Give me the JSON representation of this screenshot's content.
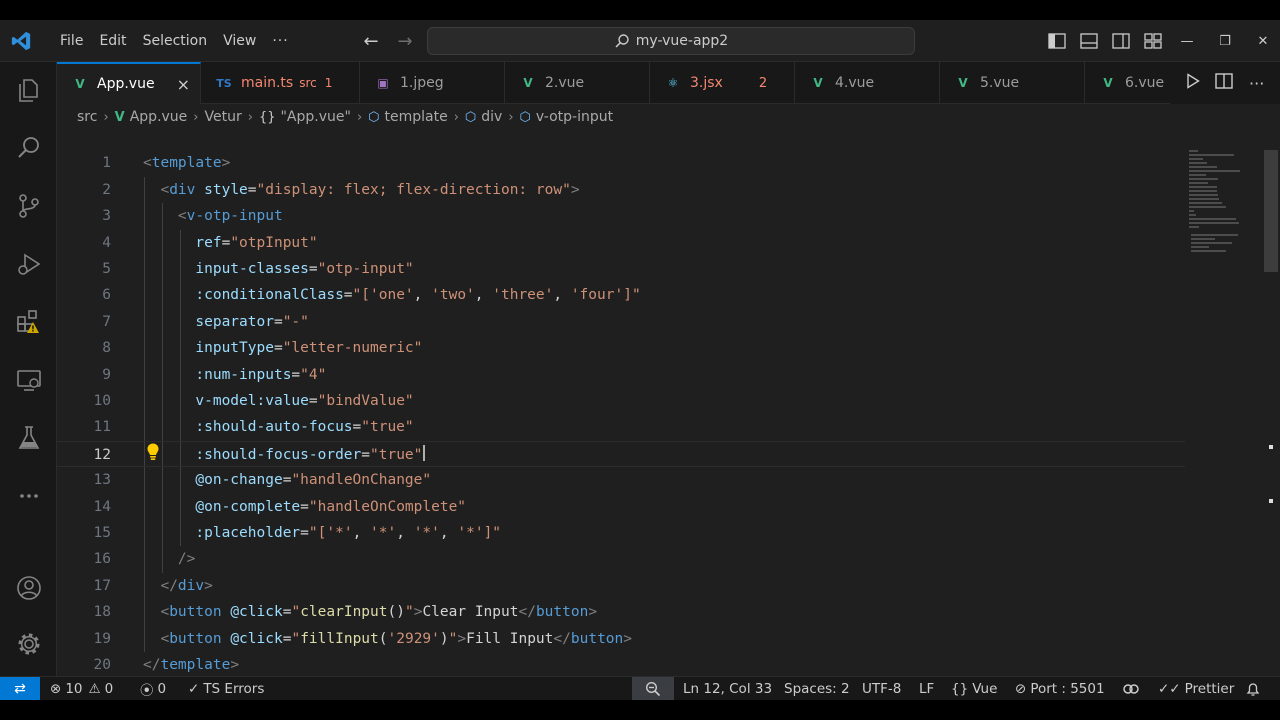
{
  "menu": {
    "items": [
      "File",
      "Edit",
      "Selection",
      "View",
      "···"
    ]
  },
  "search": {
    "text": "my-vue-app2"
  },
  "tabs": [
    {
      "label": "App.vue",
      "icon": "vue-icon",
      "active": true
    },
    {
      "label": "main.ts",
      "sub": "src",
      "badge": "1",
      "icon": "ts-icon"
    },
    {
      "label": "1.jpeg",
      "icon": "image-icon"
    },
    {
      "label": "2.vue",
      "icon": "vue-icon"
    },
    {
      "label": "3.jsx",
      "badge": "2",
      "icon": "react-icon"
    },
    {
      "label": "4.vue",
      "icon": "vue-icon"
    },
    {
      "label": "5.vue",
      "icon": "vue-icon"
    },
    {
      "label": "6.vue",
      "icon": "vue-icon"
    }
  ],
  "breadcrumb": {
    "parts": [
      "src",
      "App.vue",
      "Vetur",
      "\"App.vue\"",
      "template",
      "div",
      "v-otp-input"
    ],
    "braces": "{}"
  },
  "editor": {
    "current_line": 12,
    "lines": [
      [
        [
          "punc",
          "<"
        ],
        [
          "tag",
          "template"
        ],
        [
          "punc",
          ">"
        ]
      ],
      [
        [
          "punc",
          "  <"
        ],
        [
          "tag",
          "div"
        ],
        [
          "txt",
          " "
        ],
        [
          "attr",
          "style"
        ],
        [
          "txt",
          "="
        ],
        [
          "str",
          "\"display: flex; flex-direction: row\""
        ],
        [
          "punc",
          ">"
        ]
      ],
      [
        [
          "punc",
          "    <"
        ],
        [
          "tag",
          "v-otp-input"
        ]
      ],
      [
        [
          "txt",
          "      "
        ],
        [
          "attr",
          "ref"
        ],
        [
          "txt",
          "="
        ],
        [
          "str",
          "\"otpInput\""
        ]
      ],
      [
        [
          "txt",
          "      "
        ],
        [
          "attr",
          "input-classes"
        ],
        [
          "txt",
          "="
        ],
        [
          "str",
          "\"otp-input\""
        ]
      ],
      [
        [
          "txt",
          "      "
        ],
        [
          "attr",
          ":conditionalClass"
        ],
        [
          "txt",
          "="
        ],
        [
          "str",
          "\"["
        ],
        [
          "str",
          "'one'"
        ],
        [
          "txt",
          ", "
        ],
        [
          "str",
          "'two'"
        ],
        [
          "txt",
          ", "
        ],
        [
          "str",
          "'three'"
        ],
        [
          "txt",
          ", "
        ],
        [
          "str",
          "'four'"
        ],
        [
          "str",
          "]\""
        ]
      ],
      [
        [
          "txt",
          "      "
        ],
        [
          "attr",
          "separator"
        ],
        [
          "txt",
          "="
        ],
        [
          "str",
          "\"-\""
        ]
      ],
      [
        [
          "txt",
          "      "
        ],
        [
          "attr",
          "inputType"
        ],
        [
          "txt",
          "="
        ],
        [
          "str",
          "\"letter-numeric\""
        ]
      ],
      [
        [
          "txt",
          "      "
        ],
        [
          "attr",
          ":num-inputs"
        ],
        [
          "txt",
          "="
        ],
        [
          "str",
          "\"4\""
        ]
      ],
      [
        [
          "txt",
          "      "
        ],
        [
          "attr",
          "v-model:value"
        ],
        [
          "txt",
          "="
        ],
        [
          "str",
          "\"bindValue\""
        ]
      ],
      [
        [
          "txt",
          "      "
        ],
        [
          "attr",
          ":should-auto-focus"
        ],
        [
          "txt",
          "="
        ],
        [
          "str",
          "\"true\""
        ]
      ],
      [
        [
          "txt",
          "      "
        ],
        [
          "attr",
          ":should-focus-order"
        ],
        [
          "txt",
          "="
        ],
        [
          "str",
          "\"true\""
        ]
      ],
      [
        [
          "txt",
          "      "
        ],
        [
          "attr",
          "@on-change"
        ],
        [
          "txt",
          "="
        ],
        [
          "str",
          "\"handleOnChange\""
        ]
      ],
      [
        [
          "txt",
          "      "
        ],
        [
          "attr",
          "@on-complete"
        ],
        [
          "txt",
          "="
        ],
        [
          "str",
          "\"handleOnComplete\""
        ]
      ],
      [
        [
          "txt",
          "      "
        ],
        [
          "attr",
          ":placeholder"
        ],
        [
          "txt",
          "="
        ],
        [
          "str",
          "\"["
        ],
        [
          "str",
          "'*'"
        ],
        [
          "txt",
          ", "
        ],
        [
          "str",
          "'*'"
        ],
        [
          "txt",
          ", "
        ],
        [
          "str",
          "'*'"
        ],
        [
          "txt",
          ", "
        ],
        [
          "str",
          "'*'"
        ],
        [
          "str",
          "]\""
        ]
      ],
      [
        [
          "punc",
          "    />"
        ]
      ],
      [
        [
          "punc",
          "  </"
        ],
        [
          "tag",
          "div"
        ],
        [
          "punc",
          ">"
        ]
      ],
      [
        [
          "punc",
          "  <"
        ],
        [
          "tag",
          "button"
        ],
        [
          "txt",
          " "
        ],
        [
          "attr",
          "@click"
        ],
        [
          "txt",
          "="
        ],
        [
          "str",
          "\""
        ],
        [
          "fn",
          "clearInput"
        ],
        [
          "txt",
          "()"
        ],
        [
          "str",
          "\""
        ],
        [
          "punc",
          ">"
        ],
        [
          "txt",
          "Clear Input"
        ],
        [
          "punc",
          "</"
        ],
        [
          "tag",
          "button"
        ],
        [
          "punc",
          ">"
        ]
      ],
      [
        [
          "punc",
          "  <"
        ],
        [
          "tag",
          "button"
        ],
        [
          "txt",
          " "
        ],
        [
          "attr",
          "@click"
        ],
        [
          "txt",
          "="
        ],
        [
          "str",
          "\""
        ],
        [
          "fn",
          "fillInput"
        ],
        [
          "txt",
          "("
        ],
        [
          "str",
          "'2929'"
        ],
        [
          "txt",
          ")"
        ],
        [
          "str",
          "\""
        ],
        [
          "punc",
          ">"
        ],
        [
          "txt",
          "Fill Input"
        ],
        [
          "punc",
          "</"
        ],
        [
          "tag",
          "button"
        ],
        [
          "punc",
          ">"
        ]
      ],
      [
        [
          "punc",
          "</"
        ],
        [
          "tag",
          "template"
        ],
        [
          "punc",
          ">"
        ]
      ],
      [
        [
          "txt",
          ""
        ]
      ]
    ]
  },
  "status": {
    "errors": "10",
    "warnings": "0",
    "ports": "0",
    "ts_errors": "TS Errors",
    "position": "Ln 12, Col 33",
    "spaces": "Spaces: 2",
    "encoding": "UTF-8",
    "eol": "LF",
    "language": "Vue",
    "port": "Port : 5501",
    "prettier": "Prettier"
  },
  "colors": {
    "accent": "#0078d4",
    "vue": "#41b883",
    "ts": "#3178c6",
    "react": "#61dafb",
    "warn": "#cca700"
  }
}
